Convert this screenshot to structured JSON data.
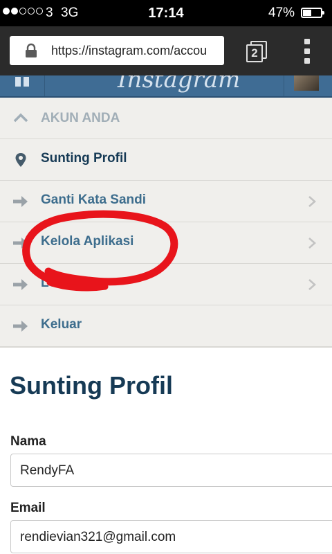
{
  "status_bar": {
    "carrier": "3",
    "network": "3G",
    "time": "17:14",
    "battery_percent": "47%",
    "battery_level": 0.47,
    "signal_strength": 2,
    "signal_max": 5
  },
  "browser": {
    "url": "https://instagram.com/accou",
    "tab_count": "2"
  },
  "header": {
    "logo_text": "Instagram"
  },
  "menu": {
    "section_title": "AKUN ANDA",
    "items": [
      {
        "label": "Sunting Profil",
        "icon": "location-pin-icon",
        "active": true
      },
      {
        "label": "Ganti Kata Sandi",
        "icon": "arrow-right-icon",
        "active": false
      },
      {
        "label": "Kelola Aplikasi",
        "icon": "arrow-right-icon",
        "active": false
      },
      {
        "label": "Lo",
        "icon": "arrow-right-icon",
        "active": false
      },
      {
        "label": "Keluar",
        "icon": "arrow-right-icon",
        "active": false
      }
    ]
  },
  "edit_profile": {
    "title": "Sunting Profil",
    "name_label": "Nama",
    "name_value": "RendyFA",
    "email_label": "Email",
    "email_value": "rendievian321@gmail.com"
  },
  "colors": {
    "accent": "#3d6d8d",
    "title": "#163a55",
    "header_bg": "#3f6c94",
    "annotation": "#e8141b",
    "menu_bg": "#f0efec"
  }
}
